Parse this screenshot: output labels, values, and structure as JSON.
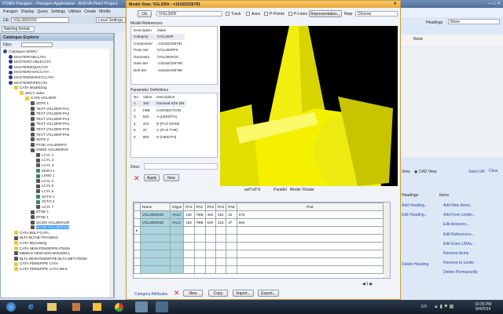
{
  "app": {
    "title": "PDMS Paragon - Paragon Application - AVEVA Plant Project",
    "menu": [
      "Paragon",
      "Display",
      "Query",
      "Settings",
      "Utilities",
      "Create",
      "Modify"
    ],
    "ce_label": "CE",
    "ce_value": "VGL300#150",
    "local_settings": "Local Settings",
    "tab": "Naming format"
  },
  "explorer": {
    "title": "Catalogue Explorer",
    "filter_label": "Filter",
    "items": [
      {
        "t": "Catalogue WORL*",
        "l": 0,
        "k": "world"
      },
      {
        "t": "MASTER/ABLCATA",
        "l": 1,
        "k": "db"
      },
      {
        "t": "MASTER/CABLECATA",
        "l": 1,
        "k": "db"
      },
      {
        "t": "MASTER/EQUICATA",
        "l": 1,
        "k": "db"
      },
      {
        "t": "MASTER/HVACCATA",
        "l": 1,
        "k": "db"
      },
      {
        "t": "MASTER/MARSTLCATA",
        "l": 1,
        "k": "db"
      },
      {
        "t": "MASTER/PIPECATA",
        "l": 1,
        "k": "db"
      },
      {
        "t": "CATA Modelizing",
        "l": 2,
        "k": "folder"
      },
      {
        "t": "SECT Valve",
        "l": 3,
        "k": "folder"
      },
      {
        "t": "CATE VGL300#",
        "l": 4,
        "k": "folder"
      },
      {
        "t": "SDTE 1",
        "l": 5,
        "k": "el"
      },
      {
        "t": "TEXT VGL300#-PA1",
        "l": 5,
        "k": "el"
      },
      {
        "t": "TEXT VGL300#-PA2",
        "l": 5,
        "k": "el"
      },
      {
        "t": "TEXT VGL300#-PA3",
        "l": 5,
        "k": "el"
      },
      {
        "t": "TEXT VGL300#-PA4",
        "l": 5,
        "k": "el"
      },
      {
        "t": "TEXT VGL300#-PA5",
        "l": 5,
        "k": "el"
      },
      {
        "t": "TEXT VGL300#-PA6",
        "l": 5,
        "k": "el"
      },
      {
        "t": "SDTE 2",
        "l": 5,
        "k": "el"
      },
      {
        "t": "PTSE VGL300#PS",
        "l": 5,
        "k": "el"
      },
      {
        "t": "GMSE VGL300#GS",
        "l": 5,
        "k": "el"
      },
      {
        "t": "LCYL 1",
        "l": 6,
        "k": "el"
      },
      {
        "t": "LCYL 2",
        "l": 6,
        "k": "el"
      },
      {
        "t": "LCYL 3",
        "l": 6,
        "k": "el"
      },
      {
        "t": "SDSH 1",
        "l": 6,
        "k": "green"
      },
      {
        "t": "LSNO 1",
        "l": 6,
        "k": "green"
      },
      {
        "t": "LCYL 4",
        "l": 6,
        "k": "el"
      },
      {
        "t": "LCYL 5",
        "l": 6,
        "k": "el"
      },
      {
        "t": "LCYL 6",
        "l": 6,
        "k": "el"
      },
      {
        "t": "SCTO 1",
        "l": 6,
        "k": "green"
      },
      {
        "t": "SCTO 2",
        "l": 6,
        "k": "green"
      },
      {
        "t": "LCYL 7",
        "l": 6,
        "k": "el"
      },
      {
        "t": "DTSE 1",
        "l": 5,
        "k": "el"
      },
      {
        "t": "BTSE 1",
        "l": 5,
        "k": "el"
      },
      {
        "t": "SCOM VGL300#100",
        "l": 5,
        "k": "el"
      },
      {
        "t": "SCOM VGL300#150",
        "l": 5,
        "k": "el",
        "sel": true
      },
      {
        "t": "CATA BOLT-CATA",
        "l": 2,
        "k": "folder"
      },
      {
        "t": "BLTA BLTAB-TRAINING",
        "l": 2,
        "k": "el"
      },
      {
        "t": "CATA MyCatalog",
        "l": 2,
        "k": "folder"
      },
      {
        "t": "CATA NEW-PDMSPIPE-ITEMS",
        "l": 2,
        "k": "folder"
      },
      {
        "t": "MBWLD NEW-NON-BOLWRL1",
        "l": 2,
        "k": "el"
      },
      {
        "t": "BLTA NEW-PDMSPIPE BLTA MET-ITEMS",
        "l": 2,
        "k": "el"
      },
      {
        "t": "CATA PDMSPIPE CATA",
        "l": 2,
        "k": "folder"
      },
      {
        "t": "CATA PDMSPIPE CATA-MKS",
        "l": 2,
        "k": "folder"
      }
    ]
  },
  "dialog": {
    "title": "Model View: VGL300# - =15192/236791",
    "ce": "CE",
    "element": "/VGL300#",
    "track": "Track",
    "axes": "Axes",
    "ppoints": "P-Points",
    "plines": "P-Lines",
    "representation": "Representation...",
    "repr_label": "Repr",
    "repr_value": "Choose",
    "model_refs_label": "Model References",
    "refs_headers": [
      "Description",
      "Value"
    ],
    "refs": [
      [
        "Category",
        "/VGL300#"
      ],
      [
        "Component",
        "=15192/236791"
      ],
      [
        "Point Set",
        "/VGL300#PS"
      ],
      [
        "Geometry",
        "/VGL300#GS"
      ],
      [
        "Data Set",
        "=15192/236789"
      ],
      [
        "Bolt Set",
        "=15192/236788"
      ]
    ],
    "params_label": "Parameter Definitions",
    "params_headers": [
      "No",
      "Value",
      "Description"
    ],
    "params": [
      [
        "1",
        "150",
        "Nominal Size DN"
      ],
      [
        "2",
        "FBB",
        "CONNECTION"
      ],
      [
        "3",
        "620",
        "A (LENGTH)"
      ],
      [
        "4",
        "315",
        "B (FLG DIAM)"
      ],
      [
        "5",
        "37",
        "C (FLG THK)"
      ],
      [
        "6",
        "900",
        "D (HEIGTH)"
      ]
    ],
    "desc_label": "Desc:",
    "apply": "Apply",
    "new": "New",
    "view_labels": [
      "se0°s0°d",
      "Parallel",
      "Model",
      "Rotate"
    ],
    "grid_headers": [
      "Name",
      "Gtype",
      "PA1",
      "PA2",
      "PA3",
      "PA4",
      "PA5",
      "PA6"
    ],
    "grid_rows": [
      [
        "VGL300#100",
        "VALV",
        "100",
        "FBB",
        "460",
        "254",
        "32",
        "675"
      ],
      [
        "VGL300#150",
        "VALV",
        "150",
        "FBB",
        "620",
        "315",
        "37",
        "900"
      ]
    ],
    "page": "1",
    "category_attributes": "Category Attributes",
    "btn_new": "New",
    "btn_copy": "Copy",
    "btn_import": "Import...",
    "btn_export": "Export..."
  },
  "right": {
    "headings_label": "Headings",
    "headings_value": "None",
    "col_none": "None",
    "view": "View",
    "cad_view": "CAD View",
    "select_all": "Select All",
    "clear": "Clea",
    "headings_col": "Headings",
    "items_col": "Items",
    "heading_links": [
      "Add Heading...",
      "Edit Heading...",
      "Delete Heading"
    ],
    "item_links": [
      "Add New Items...",
      "Add From Limbo...",
      "Edit Answers...",
      "Edit References...",
      "Edit Extra UDAs...",
      "Remove Items",
      "Remove to Limbo",
      "Delete Permanently"
    ]
  },
  "taskbar": {
    "lang": "EN",
    "time": "10:35 PM",
    "date": "8/4/2014"
  },
  "colors": {
    "accent": "#f0b44a",
    "viewport": "#000000",
    "model": "#f4f000"
  }
}
